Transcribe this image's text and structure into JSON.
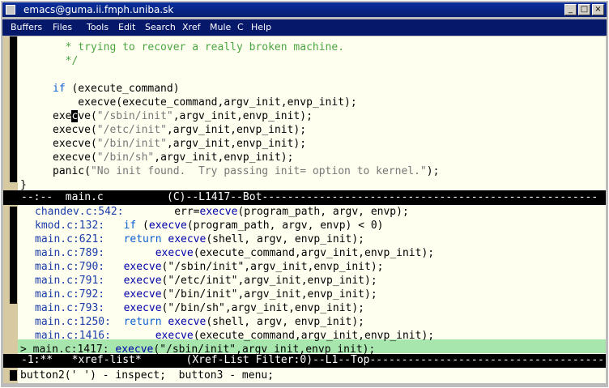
{
  "window": {
    "title": "emacs@guma.ii.fmph.uniba.sk"
  },
  "menu": [
    "Buffers",
    "Files",
    "Tools",
    "Edit",
    "Search",
    "Xref",
    "Mule",
    "C",
    "Help"
  ],
  "source_lines": [
    [
      "  ",
      {
        "t": "* trying to recover a really broken machine.",
        "c": "c-comment"
      }
    ],
    [
      "  ",
      {
        "t": "*/",
        "c": "c-comment"
      }
    ],
    [
      ""
    ],
    [
      {
        "t": "if",
        "c": "c-kw"
      },
      " (execute_command)"
    ],
    [
      "    execve(execute_command,argv_init,envp_init);"
    ],
    [
      "exe",
      {
        "t": "c",
        "c": "cursor"
      },
      "ve(",
      {
        "t": "\"/sbin/init\"",
        "c": "c-str"
      },
      ",argv_init,envp_init);"
    ],
    [
      "execve(",
      {
        "t": "\"/etc/init\"",
        "c": "c-str"
      },
      ",argv_init,envp_init);"
    ],
    [
      "execve(",
      {
        "t": "\"/bin/init\"",
        "c": "c-str"
      },
      ",argv_init,envp_init);"
    ],
    [
      "execve(",
      {
        "t": "\"/bin/sh\"",
        "c": "c-str"
      },
      ",argv_init,envp_init);"
    ],
    [
      "panic(",
      {
        "t": "\"No init found.  Try passing init= option to kernel.\"",
        "c": "c-str"
      },
      ");"
    ],
    [
      "}"
    ]
  ],
  "modeline_main": "--:--  main.c          (C)--L1417--Bot-----------------------------------------------------",
  "xref_lines": [
    [
      {
        "t": "chandev.c:542:",
        "c": "c-file"
      },
      "        err=",
      {
        "t": "execve",
        "c": "c-fn"
      },
      "(program_path, argv, envp);"
    ],
    [
      {
        "t": "kmod.c:132:",
        "c": "c-file"
      },
      "   ",
      {
        "t": "if",
        "c": "c-kw"
      },
      " (",
      {
        "t": "execve",
        "c": "c-fn"
      },
      "(program_path, argv, envp) < 0)"
    ],
    [
      {
        "t": "main.c:621:",
        "c": "c-file"
      },
      "   ",
      {
        "t": "return",
        "c": "c-kw"
      },
      " ",
      {
        "t": "execve",
        "c": "c-fn"
      },
      "(shell, argv, envp_init);"
    ],
    [
      {
        "t": "main.c:789:",
        "c": "c-file"
      },
      "        ",
      {
        "t": "execve",
        "c": "c-fn"
      },
      "(execute_command,argv_init,envp_init);"
    ],
    [
      {
        "t": "main.c:790:",
        "c": "c-file"
      },
      "   ",
      {
        "t": "execve",
        "c": "c-fn"
      },
      "(\"/sbin/init\",argv_init,envp_init);"
    ],
    [
      {
        "t": "main.c:791:",
        "c": "c-file"
      },
      "   ",
      {
        "t": "execve",
        "c": "c-fn"
      },
      "(\"/etc/init\",argv_init,envp_init);"
    ],
    [
      {
        "t": "main.c:792:",
        "c": "c-file"
      },
      "   ",
      {
        "t": "execve",
        "c": "c-fn"
      },
      "(\"/bin/init\",argv_init,envp_init);"
    ],
    [
      {
        "t": "main.c:793:",
        "c": "c-file"
      },
      "   ",
      {
        "t": "execve",
        "c": "c-fn"
      },
      "(\"/bin/sh\",argv_init,envp_init);"
    ],
    [
      {
        "t": "main.c:1250:",
        "c": "c-file"
      },
      "  ",
      {
        "t": "return",
        "c": "c-kw"
      },
      " ",
      {
        "t": "execve",
        "c": "c-fn"
      },
      "(shell, argv, envp_init);"
    ],
    [
      {
        "t": "main.c:1416:",
        "c": "c-file"
      },
      "       ",
      {
        "t": "execve",
        "c": "c-fn"
      },
      "(execute_command,argv_init,envp_init);"
    ],
    [
      "> main.c:1417: ",
      {
        "t": "execve",
        "c": "c-fn"
      },
      "(\"/sbin/init\",argv_init,envp_init);"
    ]
  ],
  "modeline_xref": "-1:**   *xref-list*       (Xref-List Filter:0)--L1--Top---------------------------------------",
  "minibuffer": "button2(' ') - inspect;  button3 - menu;"
}
